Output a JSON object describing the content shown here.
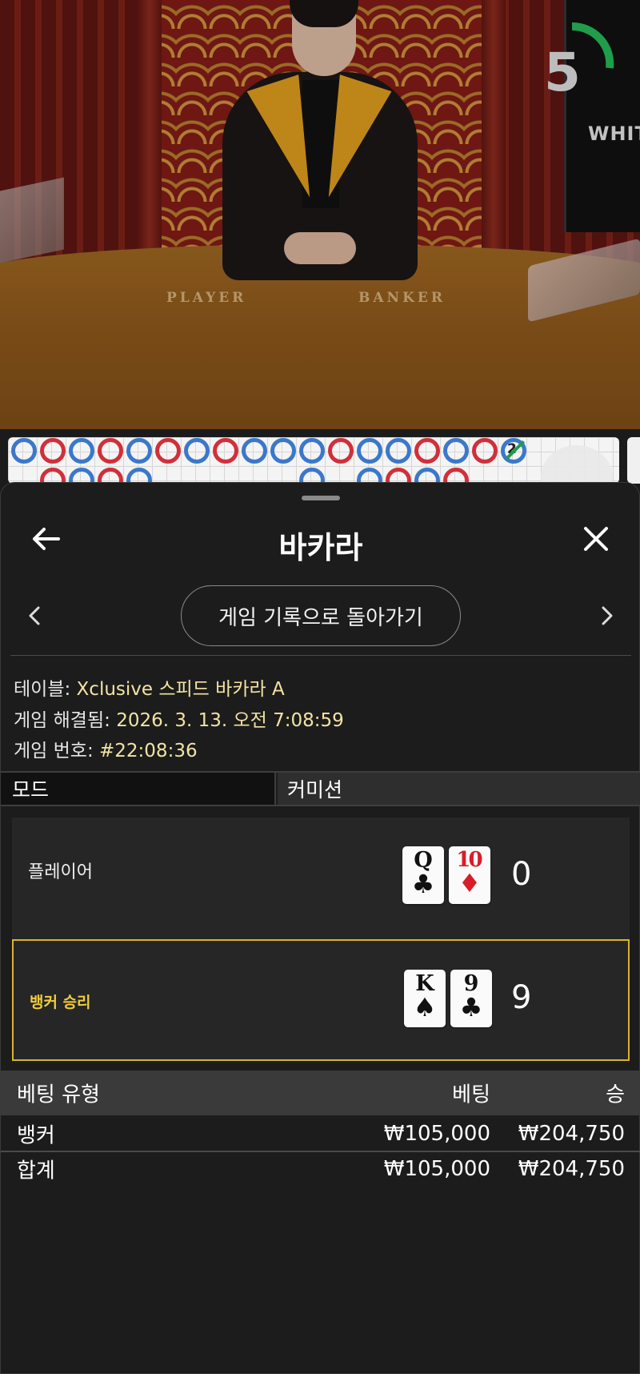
{
  "video": {
    "timer_value": "5",
    "table_labels": {
      "player": "PLAYER",
      "banker": "BANKER"
    },
    "screen_text": "WHIT"
  },
  "roadmap": {
    "row1": [
      "player",
      "banker",
      "player",
      "banker",
      "player",
      "banker",
      "player",
      "banker",
      "player",
      "player",
      "player",
      "banker",
      "player",
      "player",
      "banker",
      "player",
      "banker",
      "tie"
    ],
    "row2": [
      "empty",
      "banker",
      "player",
      "banker",
      "player",
      "empty",
      "empty",
      "empty",
      "empty",
      "empty",
      "player",
      "empty",
      "player",
      "banker",
      "player",
      "banker"
    ],
    "tie_badge": "2"
  },
  "sheet": {
    "title": "바카라",
    "back_icon": "arrow-left-icon",
    "close_icon": "close-icon",
    "back_to_history": "게임 기록으로 돌아가기",
    "meta": {
      "table_label": "테이블:",
      "table_value": "Xclusive 스피드 바카라 A",
      "resolved_label": "게임 해결됨:",
      "resolved_value": "2026. 3. 13. 오전 7:08:59",
      "number_label": "게임 번호:",
      "number_value": "#22:08:36"
    },
    "mode": {
      "left": "모드",
      "right": "커미션"
    },
    "results": {
      "player": {
        "label": "플레이어",
        "cards": [
          {
            "rank": "Q",
            "suit": "♣",
            "color": "black"
          },
          {
            "rank": "10",
            "suit": "♦",
            "color": "red"
          }
        ],
        "score": "0"
      },
      "banker": {
        "label": "뱅커 승리",
        "cards": [
          {
            "rank": "K",
            "suit": "♠",
            "color": "black"
          },
          {
            "rank": "9",
            "suit": "♣",
            "color": "black"
          }
        ],
        "score": "9"
      }
    },
    "bets": {
      "headers": {
        "type": "베팅 유형",
        "bet": "베팅",
        "win": "승"
      },
      "rows": [
        {
          "type": "뱅커",
          "bet": "₩105,000",
          "win": "₩204,750"
        }
      ],
      "total": {
        "type": "합계",
        "bet": "₩105,000",
        "win": "₩204,750"
      }
    },
    "colors": {
      "accent_gold": "#d8b332",
      "win_text": "#f0cc3c",
      "player_blue": "#3b78c9",
      "banker_red": "#d0303a"
    }
  }
}
